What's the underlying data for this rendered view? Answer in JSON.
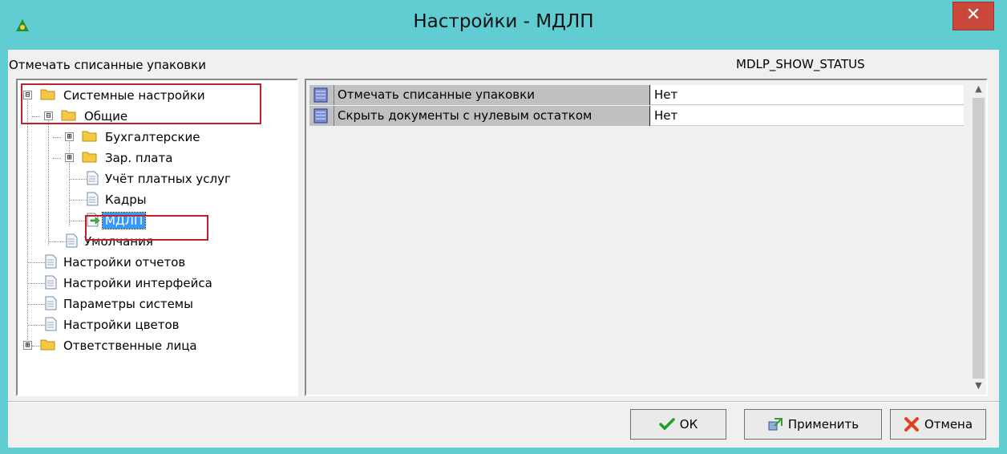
{
  "window": {
    "title": "Настройки - МДЛП",
    "close_glyph": "✕",
    "accent_color": "#5fcdd2"
  },
  "header": {
    "setting_label": "Отмечать списанные упаковки",
    "setting_key": "MDLP_SHOW_STATUS"
  },
  "tree": {
    "items": [
      {
        "label": "Системные настройки",
        "icon": "folder-icon",
        "expander": "⊟"
      },
      {
        "label": "Общие",
        "icon": "folder-icon",
        "expander": "⊟"
      },
      {
        "label": "Бухгалтерские",
        "icon": "folder-icon",
        "expander": "⊞"
      },
      {
        "label": "Зар. плата",
        "icon": "folder-icon",
        "expander": "⊞"
      },
      {
        "label": "Учёт платных услуг",
        "icon": "page-icon"
      },
      {
        "label": "Кадры",
        "icon": "page-icon"
      },
      {
        "label": "МДЛП",
        "icon": "page-arrow-icon",
        "selected": true
      },
      {
        "label": "Умолчания",
        "icon": "page-icon"
      },
      {
        "label": "Настройки отчетов",
        "icon": "page-icon"
      },
      {
        "label": "Настройки интерфейса",
        "icon": "page-icon"
      },
      {
        "label": "Параметры системы",
        "icon": "page-icon"
      },
      {
        "label": "Настройки цветов",
        "icon": "page-icon"
      },
      {
        "label": "Ответственные лица",
        "icon": "folder-icon",
        "expander": "⊞"
      }
    ]
  },
  "grid": {
    "rows": [
      {
        "name": "Отмечать списанные упаковки",
        "value": "Нет"
      },
      {
        "name": "Скрыть документы с нулевым остатком",
        "value": "Нет"
      }
    ]
  },
  "buttons": {
    "ok": "ОК",
    "apply": "Применить",
    "cancel": "Отмена"
  },
  "colors": {
    "highlight": "#c0202a",
    "selection": "#3399ff"
  }
}
